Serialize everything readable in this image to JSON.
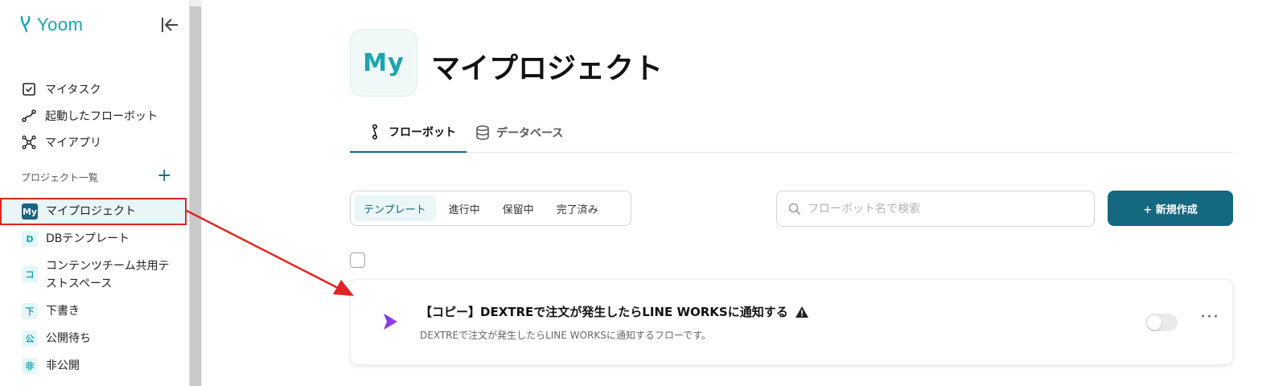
{
  "app": {
    "name": "Yoom",
    "brand_color": "#18a5b0",
    "accent_color": "#14687f"
  },
  "sidebar": {
    "nav": [
      {
        "label": "マイタスク",
        "icon": "checkbox-icon"
      },
      {
        "label": "起動したフローボット",
        "icon": "flow-icon"
      },
      {
        "label": "マイアプリ",
        "icon": "apps-icon"
      }
    ],
    "projects_title": "プロジェクト一覧",
    "projects_add": "+",
    "projects": [
      {
        "badge": "My",
        "label": "マイプロジェクト",
        "active": true
      },
      {
        "badge": "D",
        "label": "DBテンプレート"
      },
      {
        "badge": "コ",
        "label": "コンテンツチーム共用テストスペース"
      },
      {
        "badge": "下",
        "label": "下書き"
      },
      {
        "badge": "公",
        "label": "公開待ち"
      },
      {
        "badge": "非",
        "label": "非公開"
      }
    ]
  },
  "header": {
    "project_icon": "My",
    "title": "マイプロジェクト"
  },
  "tabs": [
    {
      "label": "フローボット",
      "active": true
    },
    {
      "label": "データベース"
    }
  ],
  "filters": [
    "テンプレート",
    "進行中",
    "保留中",
    "完了済み"
  ],
  "search": {
    "placeholder": "フローボット名で検索"
  },
  "new_button": "+ 新規作成",
  "flows": [
    {
      "title": "【コピー】DEXTREで注文が発生したらLINE WORKSに通知する",
      "warning_icon": "warning-icon",
      "description": "DEXTREで注文が発生したらLINE WORKSに通知するフローです。",
      "enabled": false
    }
  ],
  "more_glyph": "···"
}
